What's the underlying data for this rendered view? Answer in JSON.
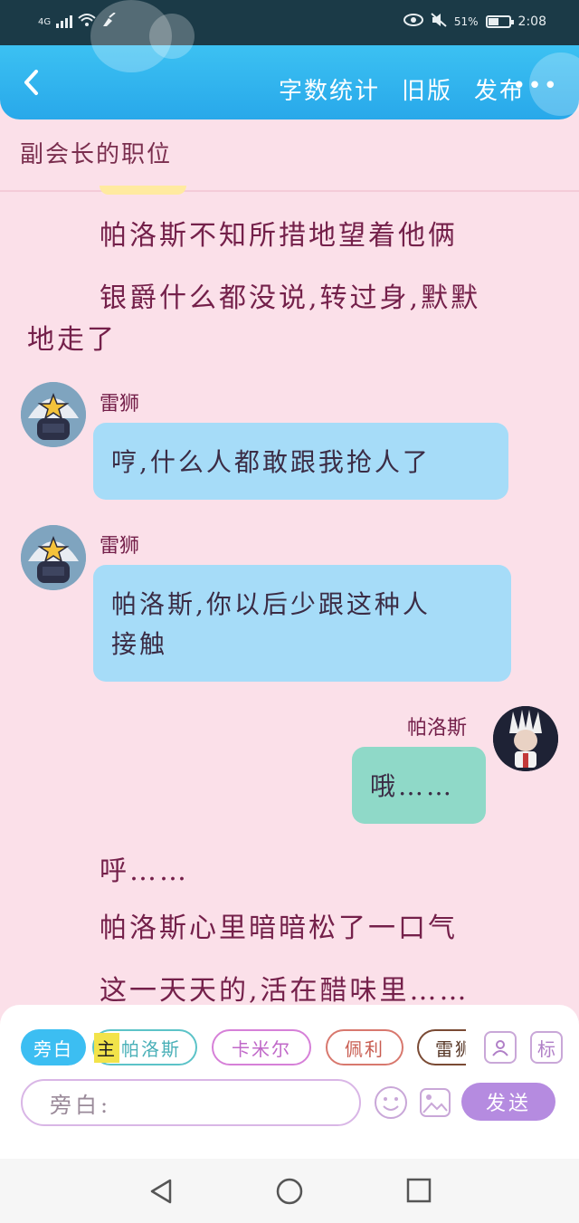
{
  "status": {
    "network": "4G",
    "battery": "51%",
    "time": "2:08",
    "battery_level": 0.51
  },
  "header": {
    "actions": [
      "字数统计",
      "旧版",
      "发布"
    ],
    "more": "•••"
  },
  "chapter_title": "副会长的职位",
  "messages": {
    "narr1": "帕洛斯不知所措地望着他俩",
    "narr2_l1": "银爵什么都没说,转过身,默默",
    "narr2_l2": "地走了",
    "m1_speaker": "雷狮",
    "m1_text": "哼,什么人都敢跟我抢人了",
    "m2_speaker": "雷狮",
    "m2_text_l1": "帕洛斯,你以后少跟这种人",
    "m2_text_l2": "接触",
    "m3_speaker": "帕洛斯",
    "m3_text": "哦……",
    "narr3": "呼……",
    "narr4": "帕洛斯心里暗暗松了一口气",
    "narr5": "这一天天的,活在醋味里……"
  },
  "composer": {
    "chips": {
      "aside": "旁白",
      "main_tag": "主",
      "palos": "帕洛斯",
      "kamil": "卡米尔",
      "pelly": "佩利",
      "leishi": "雷狮"
    },
    "icon_tag": "标",
    "input_placeholder": "旁白:",
    "send": "发送"
  },
  "colors": {
    "background": "#fbe0e9",
    "header": "#28a8ea",
    "narration_text": "#74204a",
    "bubble_blue": "#a6dcf8",
    "bubble_teal": "#8fd9c8",
    "send_button": "#b58be0"
  }
}
